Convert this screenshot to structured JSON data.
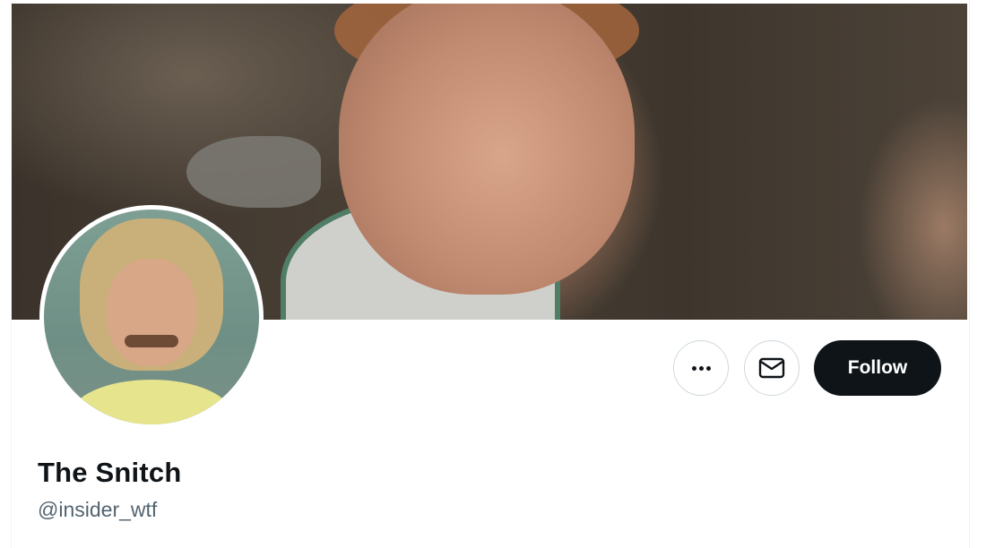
{
  "profile": {
    "display_name": "The Snitch",
    "handle": "@insider_wtf"
  },
  "actions": {
    "follow_label": "Follow",
    "more_icon": "more-horizontal-icon",
    "message_icon": "envelope-icon"
  },
  "colors": {
    "follow_bg": "#0f1419",
    "handle": "#536471",
    "border": "#cfd9de"
  }
}
